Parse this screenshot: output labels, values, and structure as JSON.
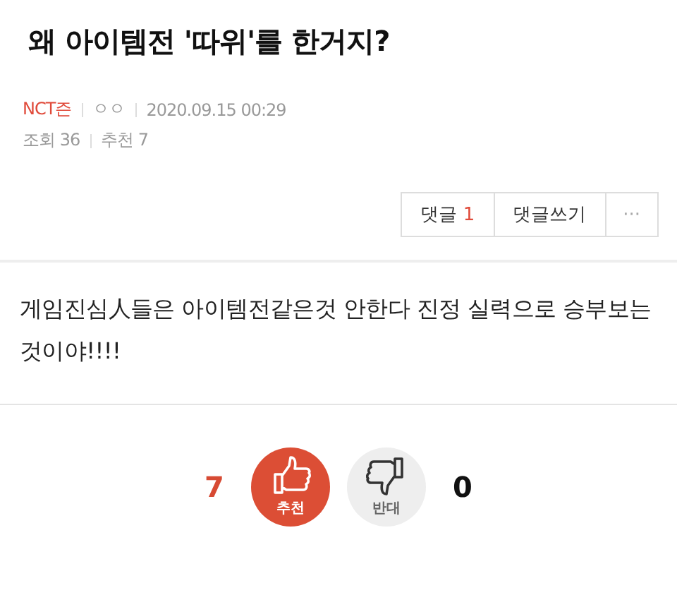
{
  "post": {
    "title": "왜 아이템전 '따위'를 한거지?",
    "author": "NCT즌",
    "author_level": "ㅇㅇ",
    "date": "2020.09.15 00:29",
    "views": "조회 36",
    "recommends": "추천 7"
  },
  "actions": {
    "comments_label": "댓글",
    "comments_count": "1",
    "write_comment": "댓글쓰기",
    "more": "···"
  },
  "body": "게임진심人들은 아이템전같은것 안한다 진정 실력으로 승부보는것이야!!!!",
  "votes": [
    {
      "kind": "up",
      "count": "7",
      "label": "추천"
    },
    {
      "kind": "down",
      "count": "0",
      "label": "반대"
    }
  ]
}
